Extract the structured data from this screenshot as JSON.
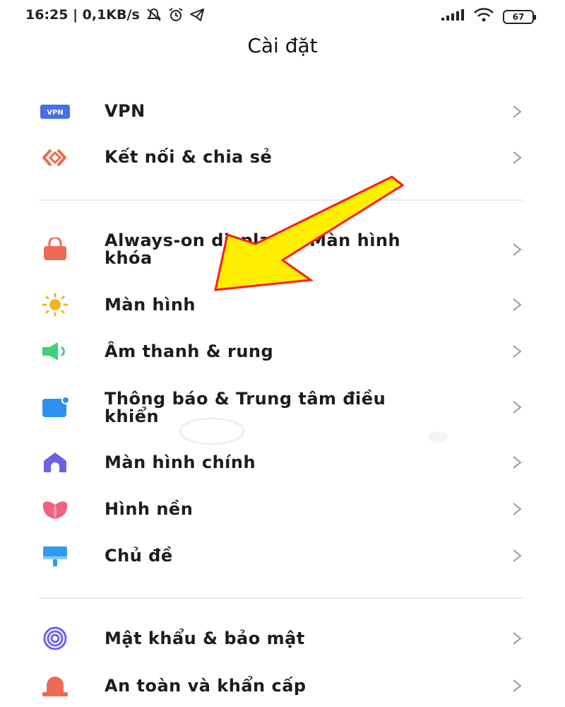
{
  "status_bar": {
    "time_speed": "16:25 | 0,1KB/s",
    "battery": "67",
    "icons": [
      "muted-alarm-icon",
      "alarm-clock-icon",
      "telegram-icon",
      "signal-icon",
      "wifi-icon",
      "battery-icon"
    ]
  },
  "header": {
    "title": "Cài đặt"
  },
  "settings": {
    "vpn": "VPN",
    "connection_sharing": "Kết nối & chia sẻ",
    "always_on_line1": "Always-on display & Màn hình",
    "always_on_line2": "khóa",
    "display": "Màn hình",
    "sound": "Âm thanh & rung",
    "notifications_line1": "Thông báo & Trung tâm điều",
    "notifications_line2": "khiển",
    "home_screen": "Màn hình chính",
    "wallpaper": "Hình nền",
    "themes": "Chủ đề",
    "passwords_security": "Mật khẩu & bảo mật",
    "safety_emergency": "An toàn và khẩn cấp"
  },
  "annotation": {
    "arrow_color": "#ffee00",
    "arrow_outline": "#ff1a1a"
  }
}
